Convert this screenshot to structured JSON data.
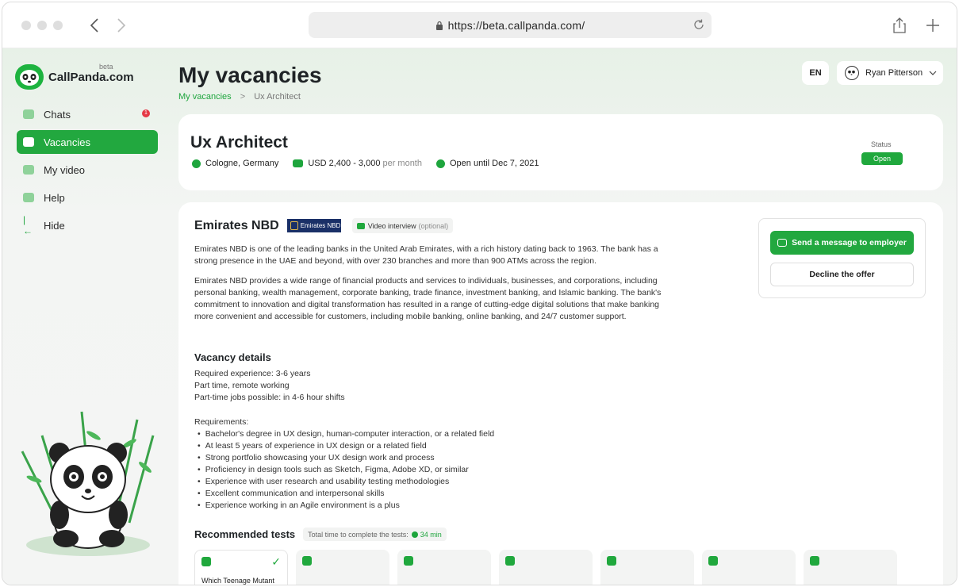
{
  "browser": {
    "url": "https://beta.callpanda.com/"
  },
  "sidebar": {
    "logo_text": "CallPanda.com",
    "logo_beta": "beta",
    "items": [
      {
        "label": "Chats",
        "badge": "1"
      },
      {
        "label": "Vacancies"
      },
      {
        "label": "My video"
      },
      {
        "label": "Help"
      },
      {
        "label": "Hide"
      }
    ]
  },
  "header": {
    "title": "My vacancies",
    "breadcrumb": [
      "My vacancies",
      "Ux Architect"
    ],
    "breadcrumb_sep": ">",
    "language": "EN",
    "user_name": "Ryan Pitterson"
  },
  "job": {
    "title": "Ux Architect",
    "location": "Cologne, Germany",
    "salary": "USD 2,400 - 3,000",
    "salary_period": "per month",
    "open_until": "Open until Dec 7, 2021",
    "status_label": "Status",
    "status_value": "Open"
  },
  "company": {
    "name": "Emirates NBD",
    "logo_text": "Emirates NBD",
    "video_chip": "Video interview",
    "video_chip_optional": "(optional)",
    "desc1": "Emirates NBD is one of the leading banks in the United Arab Emirates, with a rich history dating back to 1963. The bank has a strong presence in the UAE and beyond, with over 230 branches and more than 900 ATMs across the region.",
    "desc2": "Emirates NBD provides a wide range of financial products and services to individuals, businesses, and corporations, including personal banking, wealth management, corporate banking, trade finance, investment banking, and Islamic banking. The bank's commitment to innovation and digital transformation has resulted in a range of cutting-edge digital solutions that make banking more convenient and accessible for customers, including mobile banking, online banking, and 24/7 customer support."
  },
  "vacancy": {
    "heading": "Vacancy details",
    "lines": [
      "Required experience: 3-6 years",
      "Part time, remote working",
      "Part-time jobs possible: in 4-6 hour shifts"
    ],
    "requirements_heading": "Requirements:",
    "requirements": [
      "Bachelor's degree in UX design, human-computer interaction, or a related field",
      "At least 5 years of experience in UX design or a related field",
      "Strong portfolio showcasing your UX design work and process",
      "Proficiency in design tools such as Sketch, Figma, Adobe XD, or similar",
      "Experience with user research and usability testing methodologies",
      "Excellent communication and interpersonal skills",
      "Experience working in an Agile environment is a plus"
    ]
  },
  "tests": {
    "heading": "Recommended tests",
    "time_label": "Total time to complete the tests:",
    "time_value": "34 min",
    "first_name": "Which Teenage Mutant",
    "count": 7
  },
  "actions": {
    "send_message": "Send a message to employer",
    "decline": "Decline the offer"
  },
  "colors": {
    "accent": "#22a83f",
    "status_badge": "#e53946",
    "company_logo_bg": "#1a3067"
  }
}
